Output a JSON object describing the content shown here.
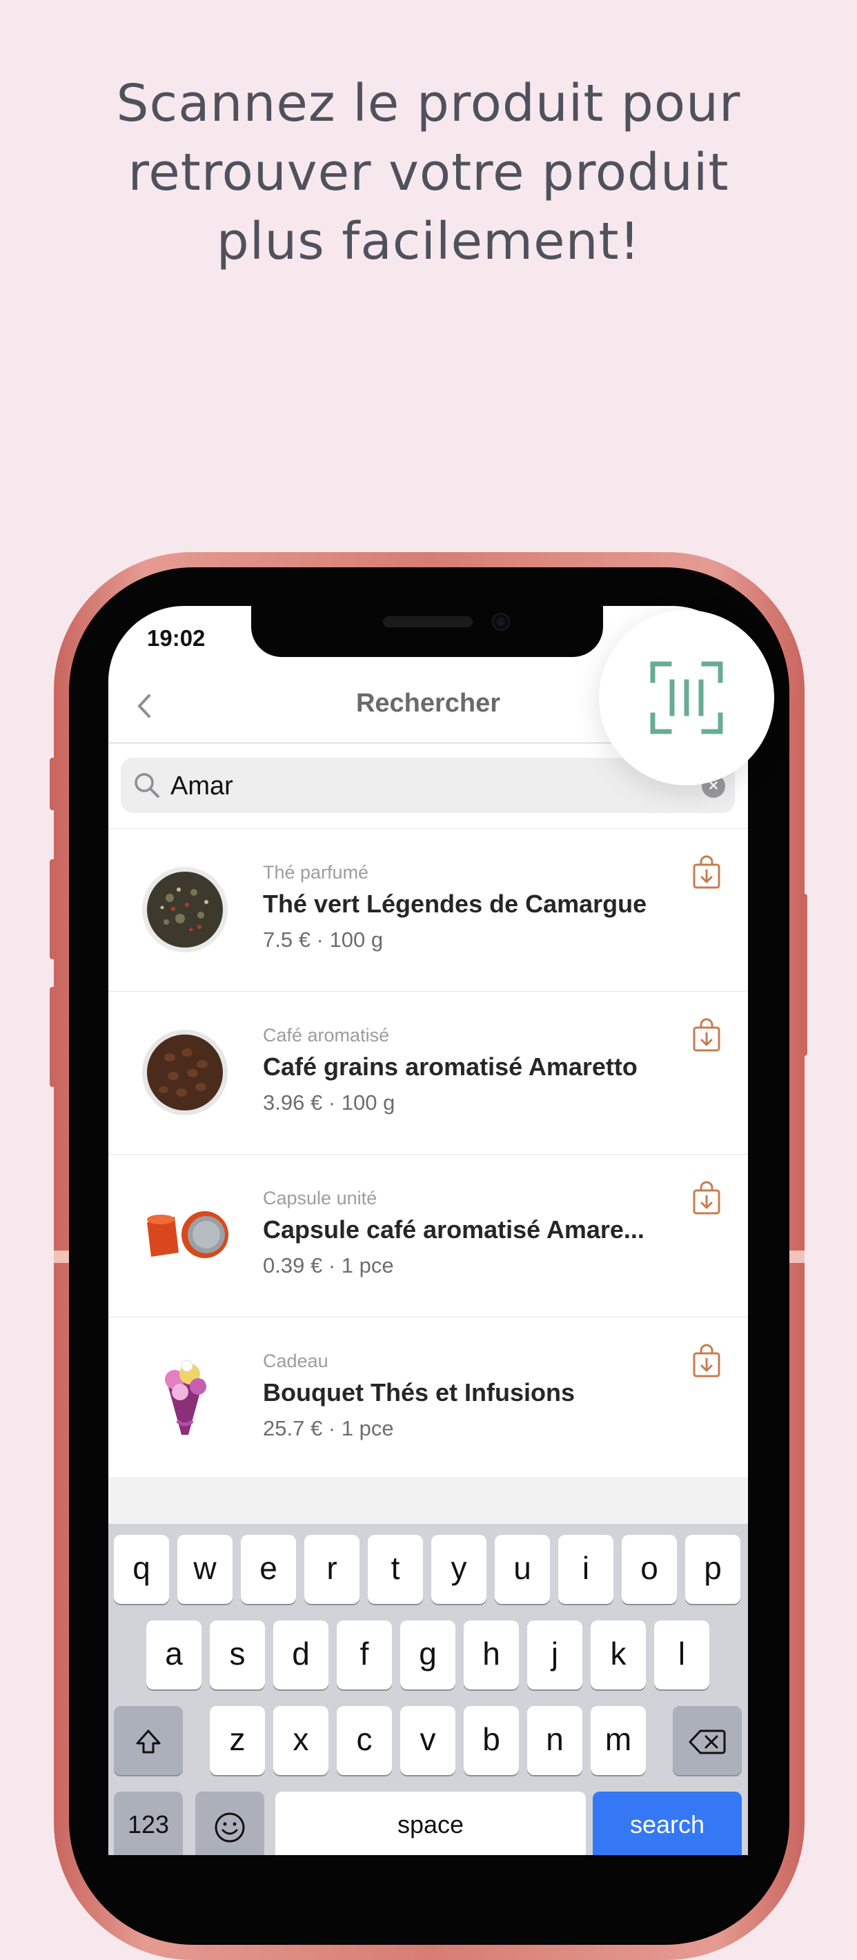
{
  "headline": {
    "lines": [
      "Scannez le produit pour",
      "retrouver votre produit",
      "plus facilement!"
    ]
  },
  "status_bar": {
    "time": "19:02"
  },
  "navbar": {
    "title": "Rechercher",
    "back_icon": "chevron-left-icon"
  },
  "search": {
    "value": "Amar",
    "icon": "search-icon",
    "clear_icon": "clear-icon"
  },
  "scan_button": {
    "icon": "barcode-scan-icon",
    "color": "#6aab95"
  },
  "results": [
    {
      "category": "Thé parfumé",
      "name": "Thé vert Légendes de Camargue",
      "price": "7.5 € · 100 g",
      "thumb": "tea-bowl",
      "cart_icon": "shopping-bag-download-icon"
    },
    {
      "category": "Café aromatisé",
      "name": "Café grains aromatisé Amaretto",
      "price": "3.96 € · 100 g",
      "thumb": "coffee-beans-bowl",
      "cart_icon": "shopping-bag-download-icon"
    },
    {
      "category": "Capsule unité",
      "name": "Capsule café aromatisé Amare...",
      "price": "0.39 € · 1 pce",
      "thumb": "coffee-capsules",
      "cart_icon": "shopping-bag-download-icon"
    },
    {
      "category": "Cadeau",
      "name": "Bouquet Thés et Infusions",
      "price": "25.7 € · 1 pce",
      "thumb": "gift-bouquet",
      "cart_icon": "shopping-bag-download-icon"
    }
  ],
  "keyboard": {
    "row1": [
      "q",
      "w",
      "e",
      "r",
      "t",
      "y",
      "u",
      "i",
      "o",
      "p"
    ],
    "row2": [
      "a",
      "s",
      "d",
      "f",
      "g",
      "h",
      "j",
      "k",
      "l"
    ],
    "row3": [
      "z",
      "x",
      "c",
      "v",
      "b",
      "n",
      "m"
    ],
    "shift_icon": "shift-icon",
    "delete_icon": "backspace-icon",
    "numbers_label": "123",
    "emoji_icon": "emoji-icon",
    "space_label": "space",
    "search_label": "search"
  },
  "colors": {
    "background": "#f7e8ed",
    "accent_cart": "#c77c4d",
    "search_key": "#3478f6",
    "phone_frame": "#d77d74"
  }
}
